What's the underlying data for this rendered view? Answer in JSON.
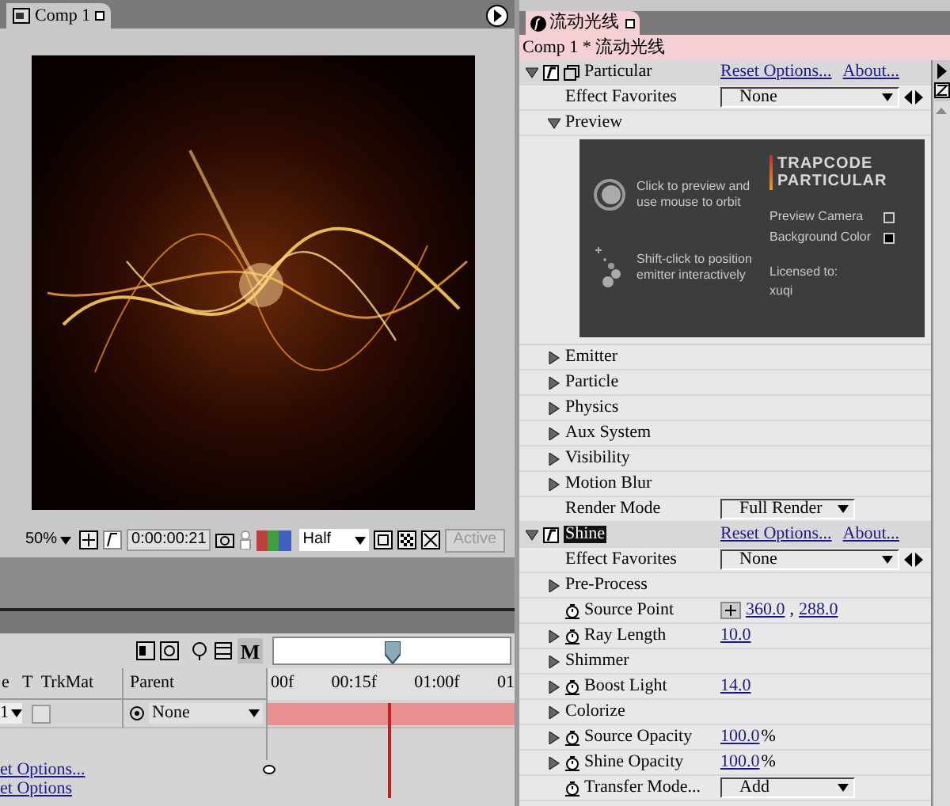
{
  "comp_panel": {
    "tab": "Comp 1",
    "toolbar": {
      "zoom": "50%",
      "timecode": "0:00:00:21",
      "resolution": "Half",
      "view": "Active"
    }
  },
  "timeline": {
    "m_button": "M",
    "columns": [
      "e",
      "T  TrkMat",
      "Parent"
    ],
    "ruler": [
      "00f",
      "00:15f",
      "01:00f",
      "01"
    ],
    "layer": {
      "matte": "1",
      "parent": "None"
    },
    "links": [
      "et Options...",
      "et Options"
    ]
  },
  "effect_panel": {
    "tab": "流动光线",
    "header": "Comp 1 * 流动光线",
    "rows": [
      {
        "kind": "effect",
        "label": "Particular",
        "expanded": true,
        "selected": false,
        "links": [
          "Reset Options...",
          "About..."
        ]
      },
      {
        "kind": "favorites",
        "label": "Effect Favorites",
        "value": "None"
      },
      {
        "kind": "group",
        "label": "Preview",
        "expanded": true
      },
      {
        "kind": "preview",
        "orbit_hint": "Click to preview and use mouse to orbit",
        "emitter_hint": "Shift-click to position emitter interactively",
        "logo": [
          "TRAPCODE",
          "PARTICULAR"
        ],
        "options": [
          {
            "label": "Preview Camera",
            "checked": false
          },
          {
            "label": "Background Color",
            "checked": true
          }
        ],
        "license_label": "Licensed to:",
        "licensee": "xuqi"
      },
      {
        "kind": "group",
        "label": "Emitter",
        "expanded": false
      },
      {
        "kind": "group",
        "label": "Particle",
        "expanded": false
      },
      {
        "kind": "group",
        "label": "Physics",
        "expanded": false
      },
      {
        "kind": "group",
        "label": "Aux System",
        "expanded": false
      },
      {
        "kind": "group",
        "label": "Visibility",
        "expanded": false
      },
      {
        "kind": "group",
        "label": "Motion Blur",
        "expanded": false
      },
      {
        "kind": "dropdown",
        "label": "Render Mode",
        "value": "Full Render"
      },
      {
        "kind": "effect",
        "label": "Shine",
        "expanded": true,
        "selected": true,
        "links": [
          "Reset Options...",
          "About..."
        ]
      },
      {
        "kind": "favorites",
        "label": "Effect Favorites",
        "value": "None"
      },
      {
        "kind": "group",
        "label": "Pre-Process",
        "expanded": false
      },
      {
        "kind": "point",
        "label": "Source Point",
        "values": [
          "360.0",
          "288.0"
        ],
        "separator": ","
      },
      {
        "kind": "property",
        "label": "Ray Length",
        "value": "10.0",
        "expanded": false
      },
      {
        "kind": "group",
        "label": "Shimmer",
        "expanded": false
      },
      {
        "kind": "property",
        "label": "Boost Light",
        "value": "14.0",
        "expanded": false
      },
      {
        "kind": "group",
        "label": "Colorize",
        "expanded": false
      },
      {
        "kind": "property",
        "label": "Source Opacity",
        "value": "100.0",
        "unit": "%",
        "expanded": false
      },
      {
        "kind": "property",
        "label": "Shine Opacity",
        "value": "100.0",
        "unit": "%",
        "expanded": false
      },
      {
        "kind": "mode",
        "label": "Transfer Mode...",
        "value": "Add"
      }
    ]
  }
}
